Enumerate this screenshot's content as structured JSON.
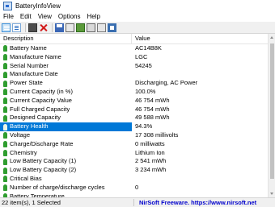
{
  "window": {
    "title": "BatteryInfoView"
  },
  "menu": [
    "File",
    "Edit",
    "View",
    "Options",
    "Help"
  ],
  "toolbar": {
    "buttons": [
      {
        "name": "properties-view-icon",
        "selected": true
      },
      {
        "name": "list-view-icon",
        "selected": false
      },
      {
        "name": "monitor-icon",
        "selected": false
      },
      {
        "name": "delete-x-icon",
        "selected": false
      },
      {
        "name": "save-icon",
        "selected": false
      },
      {
        "name": "copy-icon",
        "selected": false
      },
      {
        "name": "html-report-icon",
        "selected": false
      },
      {
        "name": "html-report-all-icon",
        "selected": false
      },
      {
        "name": "search-icon",
        "selected": false
      },
      {
        "name": "exit-icon",
        "selected": false
      }
    ]
  },
  "table": {
    "headers": {
      "description": "Description",
      "value": "Value"
    },
    "rows": [
      {
        "label": "Battery Name",
        "value": "AC14B8K"
      },
      {
        "label": "Manufacture Name",
        "value": "LGC"
      },
      {
        "label": "Serial Number",
        "value": "54245"
      },
      {
        "label": "Manufacture Date",
        "value": ""
      },
      {
        "label": "Power State",
        "value": "Discharging, AC Power"
      },
      {
        "label": "Current Capacity (in %)",
        "value": "100.0%"
      },
      {
        "label": "Current Capacity Value",
        "value": "46 754 mWh"
      },
      {
        "label": "Full Charged Capacity",
        "value": "46 754 mWh"
      },
      {
        "label": "Designed Capacity",
        "value": "49 588 mWh"
      },
      {
        "label": "Battery Health",
        "value": "94.3%",
        "selected": true
      },
      {
        "label": "Voltage",
        "value": "17 308 millivolts"
      },
      {
        "label": "Charge/Discharge Rate",
        "value": "0 milliwatts"
      },
      {
        "label": "Chemistry",
        "value": "Lithium Ion"
      },
      {
        "label": "Low Battery Capacity (1)",
        "value": "2 541 mWh"
      },
      {
        "label": "Low Battery Capacity (2)",
        "value": "3 234 mWh"
      },
      {
        "label": "Critical Bias",
        "value": ""
      },
      {
        "label": "Number of charge/discharge cycles",
        "value": "0"
      },
      {
        "label": "Battery Temperature",
        "value": ""
      }
    ]
  },
  "status": {
    "items": "22 item(s), 1 Selected",
    "credit": "NirSoft Freeware. https://www.nirsoft.net"
  }
}
